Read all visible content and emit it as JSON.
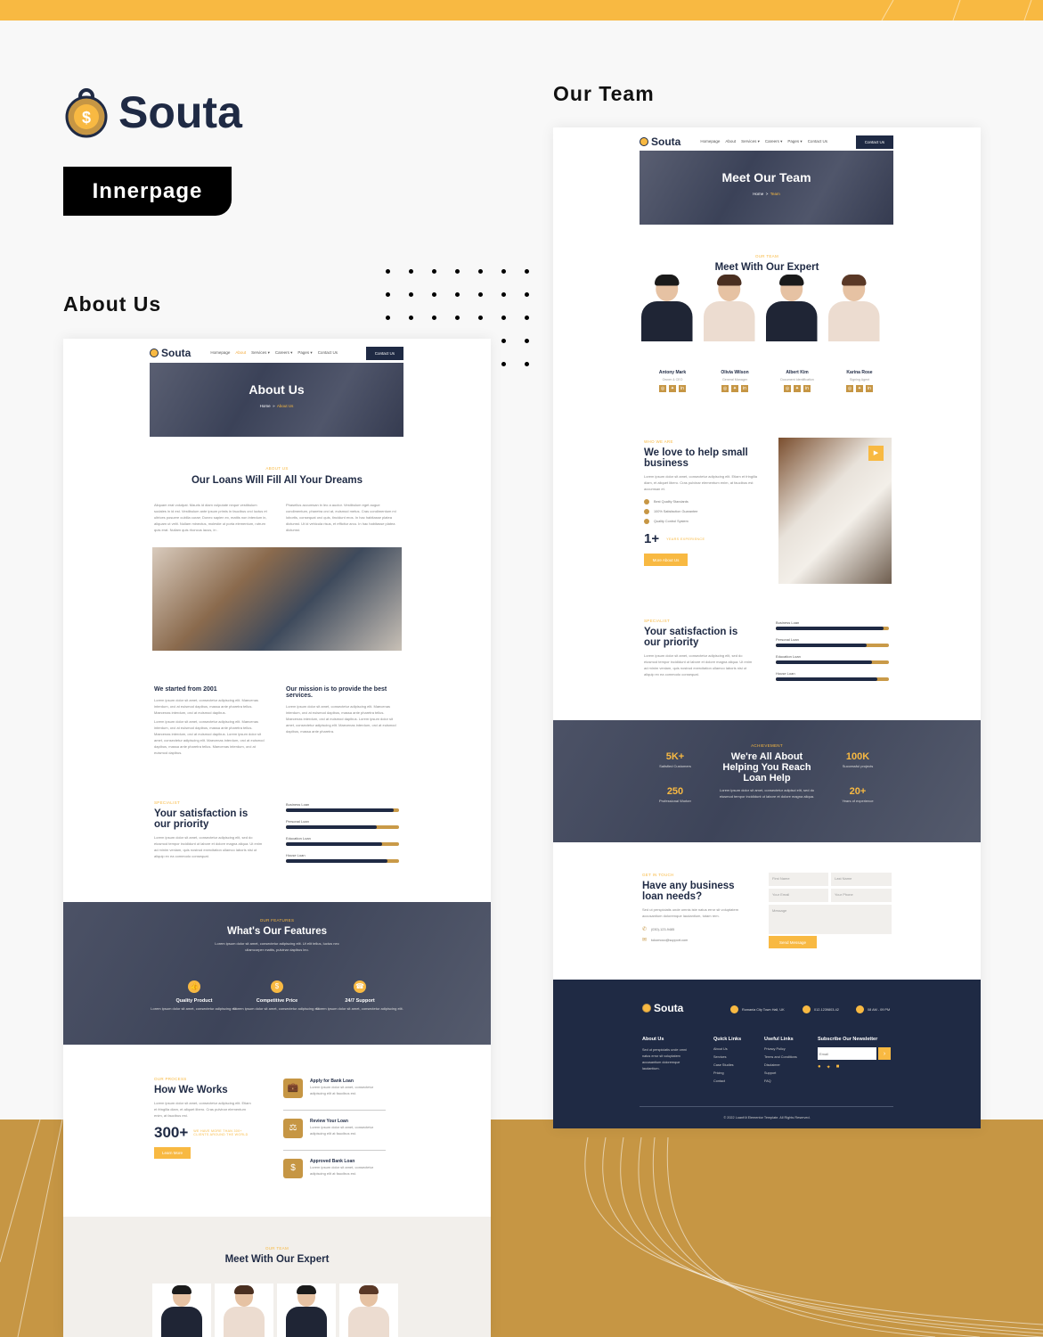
{
  "brand": {
    "name": "Souta",
    "badge": "Innerpage"
  },
  "labels": {
    "about": "About Us",
    "team": "Our Team"
  },
  "colors": {
    "accent": "#f8b942",
    "gold": "#c69644",
    "navy": "#1f2a44"
  },
  "nav": {
    "logo": "Souta",
    "links": [
      "Homepage",
      "About",
      "Services ▾",
      "Careers ▾",
      "Pages ▾",
      "Contact Us"
    ],
    "cta": "Contact Us"
  },
  "about": {
    "hero": {
      "title": "About Us",
      "crumb_home": "Home",
      "crumb_sep": "»",
      "crumb_current": "About Us"
    },
    "intro": {
      "eyebrow": "About Us",
      "title": "Our Loans Will Fill All Your Dreams",
      "col1": "Aliquam erat volutpat. Mauris id diam vulputate neque vestibulum sodales in id est. Vestibulum ante ipsum primis in faucibus orci luctus et ultrices posuere cubilia curae; Donec sapien ex, mattis non interdum in, aliquam ut velit. Nullam minectus, molestie ut porta elementum, rutrum quis erat. Nullam quis rhoncus lacus, in .",
      "col2": "Phasellus accumsan in leo a auctor. Vestibulum eget augue condimentum, pharetra orci at, euismod metus. Cras condimentum mi lobortis, consequat orci quis, tincidunt eros. In hac habitasse platea dictumst. Ut id vehicula risus, et efficitur arcu. In hac habitasse platea dictumst."
    },
    "history": {
      "title1": "We started from 2001",
      "text1a": "Lorem ipsum dolor sit amet, consectetur adipiscing elit. Maecenas interdum, orci at euismod dapibus, massa ante pharetra tellus. Maecenas interdum, orci at euismod dapibus.",
      "text1b": "Lorem ipsum dolor sit amet, consectetur adipiscing elit. Maecenas interdum, orci at euismod dapibus, massa ante pharetra tellus. Maecenas interdum, orci at euismod dapibus. Lorem ipsum dolor sit amet, consectetur adipiscing elit. Maecenas interdum, orci at euismod dapibus, massa ante pharetra tellus. Maecenas interdum, orci at euismod dapibus.",
      "title2": "Our mission is to provide the best services.",
      "text2": "Lorem ipsum dolor sit amet, consectetur adipiscing elit. Maecenas interdum, orci at euismod dapibus, massa ante pharetra tellus. Maecenas interdum, orci at euismod dapibus. Lorem ipsum dolor sit amet, consectetur adipiscing elit. Maecenas interdum, orci at euismod dapibus, massa ante pharetra."
    },
    "features": {
      "eyebrow": "Our Features",
      "title": "What's Our Features",
      "text": "Lorem ipsum dolor sit amet, consectetur adipiscing elit. Ut elit tellus, luctus nec ullamcorper mattis, pulvinar dapibus leo.",
      "items": [
        {
          "icon": "thumbs-up-icon",
          "glyph": "👍",
          "title": "Quality Product",
          "text": "Lorem ipsum dolor sit amet, consectetur adipiscing elit."
        },
        {
          "icon": "dollar-icon",
          "glyph": "$",
          "title": "Competitive Price",
          "text": "Lorem ipsum dolor sit amet, consectetur adipiscing elit."
        },
        {
          "icon": "support-icon",
          "glyph": "☎",
          "title": "24/7 Support",
          "text": "Lorem ipsum dolor sit amet, consectetur adipiscing elit."
        }
      ]
    },
    "process": {
      "eyebrow": "Our Process",
      "title": "How We Works",
      "text": "Lorem ipsum dolor sit amet, consectetur adipiscing elit. Etiam et fringilla diam, et aliquet libero. Cras pulvinar elementum enim, at faucibus est.",
      "count": "300+",
      "count_label": "We have more than 300+ clients around the world",
      "button": "Learn More",
      "steps": [
        {
          "icon": "briefcase-icon",
          "glyph": "💼",
          "title": "Apply for Bank Loan",
          "text": "Lorem ipsum dolor sit amet, consectetur adipiscing elit at faucibus est."
        },
        {
          "icon": "scale-icon",
          "glyph": "⚖",
          "title": "Review Your Loan",
          "text": "Lorem ipsum dolor sit amet, consectetur adipiscing elit at faucibus est."
        },
        {
          "icon": "money-bag-icon",
          "glyph": "$",
          "title": "Approved Bank Loan",
          "text": "Lorem ipsum dolor sit amet, consectetur adipiscing elit at faucibus est."
        }
      ]
    },
    "team": {
      "eyebrow": "Our Team",
      "title": "Meet With Our Expert"
    }
  },
  "satisfaction": {
    "eyebrow": "Specialist",
    "title": "Your satisfaction is our priority",
    "text": "Lorem ipsum dolor sit amet, consectetur adipiscing elit, sed do eiusmod tempor incididunt ut labore et dolore magna aliqua. Ut enim ad minim veniam, quis nostrud exercitation ullamco laboris nisi ut aliquip ex ea commodo consequat.",
    "bars": [
      {
        "label": "Business Loan",
        "value": 0.95
      },
      {
        "label": "Personal Loan",
        "value": 0.8
      },
      {
        "label": "Education Loan",
        "value": 0.85
      },
      {
        "label": "House Loan",
        "value": 0.9
      }
    ]
  },
  "team_page": {
    "hero": {
      "title": "Meet Our Team",
      "crumb_home": "Home",
      "crumb_sep": ">",
      "crumb_current": "Team"
    },
    "eyebrow": "Our Team",
    "title": "Meet With Our Expert",
    "members": [
      {
        "name": "Antony Mark",
        "role": "Owner & CEO"
      },
      {
        "name": "Olivia Wilson",
        "role": "General Manager"
      },
      {
        "name": "Albert Kim",
        "role": "Document Identification"
      },
      {
        "name": "Karina Rose",
        "role": "Signing Agent"
      }
    ],
    "who": {
      "eyebrow": "Who We Are",
      "title": "We love to help small business",
      "text": "Lorem ipsum dolor sit amet, consectetur adipiscing elit. Etiam et fringilla diam, et aliquet libero. Cras pulvinar elementum enim, at faucibus est accumsan et.",
      "checks": [
        "Best Quality Standards",
        "100% Satisfaction Guarantee",
        "Quality Control System"
      ],
      "years": "1+",
      "years_label": "Years Experience",
      "button": "More About Us"
    },
    "achievement": {
      "eyebrow": "Achievement",
      "title": "We're All About Helping You Reach Loan Help",
      "text": "Lorem ipsum dolor sit amet, consectetur adipisci elit, sed do eiusmod tempor incididunt ut labore et dolore magna aliqua.",
      "stats": [
        {
          "value": "5K+",
          "label": "Satisfied Customers"
        },
        {
          "value": "250",
          "label": "Professional Worker"
        },
        {
          "value": "100K",
          "label": "Successful projects"
        },
        {
          "value": "20+",
          "label": "Years of experience"
        }
      ]
    },
    "contact": {
      "eyebrow": "Get In Touch",
      "title": "Have any business loan needs?",
      "text": "Sed ut perspiciatis unde omnis iste natus error sit voluptatem accusantium doloremque laudantium, totam rem.",
      "phone": "(030)-123-9485",
      "email": "tokomoco@support.com",
      "fields": {
        "first": "First Name",
        "last": "Last Name",
        "email": "Your Email",
        "phone": "Your Phone",
        "message": "Message"
      },
      "button": "Send Message"
    },
    "footer": {
      "logo": "Souta",
      "address": "Romania City Town Hall, UK",
      "phone": "012-1239803-42",
      "hours": "08 AM - 09 PM",
      "about_title": "About Us",
      "about_text": "Sed ut perspiciatis unde omni natus error sit voluptatem accusantium doloremque laudantium.",
      "quick_title": "Quick Links",
      "quick": [
        "About Us",
        "Services",
        "Case Studies",
        "Pricing",
        "Contact"
      ],
      "useful_title": "Useful Links",
      "useful": [
        "Privacy Policy",
        "Terms and Conditions",
        "Disclaimer",
        "Support",
        "FAQ"
      ],
      "newsletter_title": "Subscribe Our Newsletter",
      "email_placeholder": "Email",
      "submit": "›",
      "copyright": "© 2022 LoanKit Elementor Template. All Rights Reserved."
    }
  }
}
